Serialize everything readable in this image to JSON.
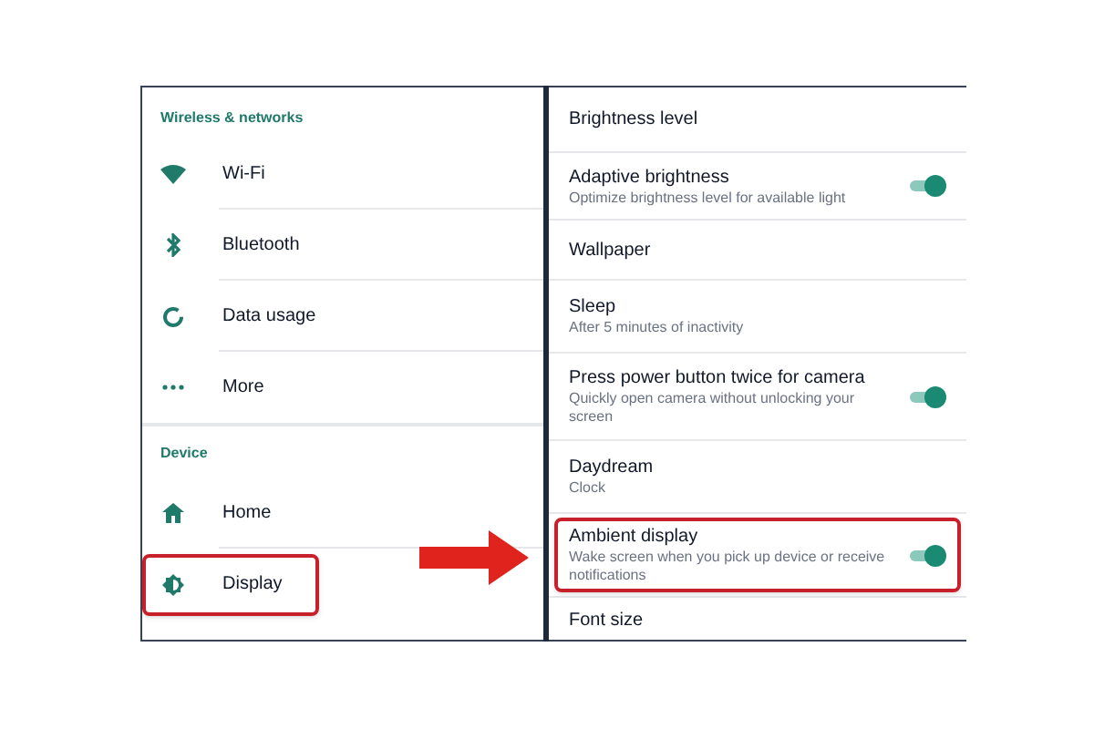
{
  "left_panel": {
    "sections": [
      {
        "header": "Wireless & networks",
        "items": [
          {
            "label": "Wi-Fi",
            "kind": "wifi",
            "highlighted": false
          },
          {
            "label": "Bluetooth",
            "kind": "bluetooth",
            "highlighted": false
          },
          {
            "label": "Data usage",
            "kind": "data",
            "highlighted": false
          },
          {
            "label": "More",
            "kind": "more",
            "highlighted": false
          }
        ]
      },
      {
        "header": "Device",
        "items": [
          {
            "label": "Home",
            "kind": "home",
            "highlighted": false
          },
          {
            "label": "Display",
            "kind": "display",
            "highlighted": true
          }
        ]
      }
    ]
  },
  "right_panel": {
    "items": [
      {
        "title": "Brightness level",
        "highlighted": false
      },
      {
        "title": "Adaptive brightness",
        "subtitle": "Optimize brightness level for available light",
        "on": true,
        "highlighted": false
      },
      {
        "title": "Wallpaper",
        "highlighted": false
      },
      {
        "title": "Sleep",
        "subtitle": "After 5 minutes of inactivity",
        "highlighted": false
      },
      {
        "title": "Press power button twice for camera",
        "subtitle": "Quickly open camera without unlocking your screen",
        "on": true,
        "highlighted": false
      },
      {
        "title": "Daydream",
        "subtitle": "Clock",
        "highlighted": false
      },
      {
        "title": "Ambient display",
        "subtitle": "Wake screen when you pick up device or receive notifications",
        "on": true,
        "highlighted": true
      },
      {
        "title": "Font size",
        "highlighted": false
      }
    ]
  }
}
